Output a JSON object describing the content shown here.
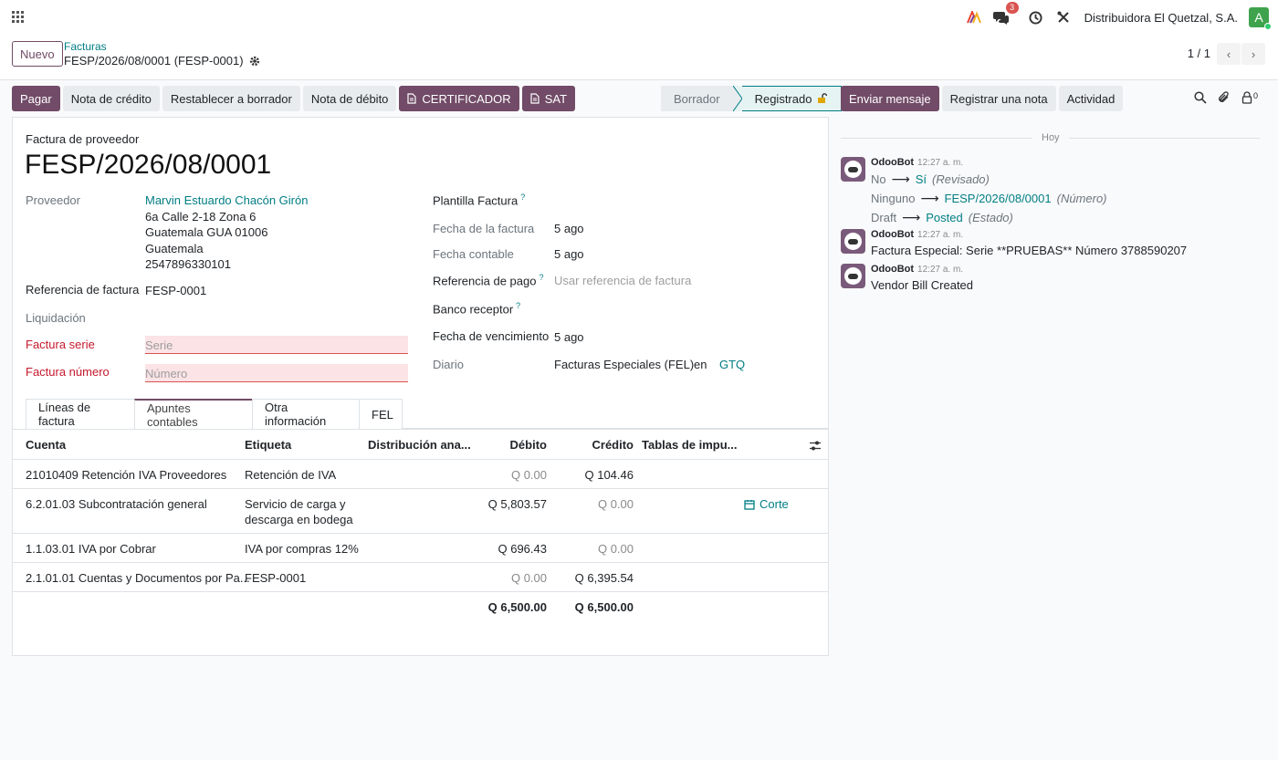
{
  "navbar": {
    "chat_badge": "3",
    "company": "Distribuidora El Quetzal, S.A.",
    "avatar_letter": "A"
  },
  "control_panel": {
    "new_label": "Nuevo",
    "breadcrumb_parent": "Facturas",
    "breadcrumb_current": "FESP/2026/08/0001 (FESP-0001)",
    "pager": "1 / 1"
  },
  "actions": {
    "pay": "Pagar",
    "credit_note": "Nota de crédito",
    "reset_draft": "Restablecer a borrador",
    "debit_note": "Nota de débito",
    "certificador": "CERTIFICADOR",
    "sat": "SAT"
  },
  "status": {
    "stages": [
      "Borrador",
      "Registrado"
    ]
  },
  "chatter_buttons": {
    "send_message": "Enviar mensaje",
    "log_note": "Registrar una nota",
    "activity": "Actividad",
    "followers_count": "0"
  },
  "form": {
    "type_label": "Factura de proveedor",
    "name": "FESP/2026/08/0001",
    "left": {
      "proveedor_label": "Proveedor",
      "proveedor_name": "Marvin Estuardo Chacón Girón",
      "address_lines": [
        "6a Calle 2-18 Zona 6",
        "Guatemala GUA 01006",
        "Guatemala",
        "2547896330101"
      ],
      "ref_label": "Referencia de factura",
      "ref_value": "FESP-0001",
      "liquidacion_label": "Liquidación",
      "serie_label": "Factura serie",
      "serie_placeholder": "Serie",
      "numero_label": "Factura número",
      "numero_placeholder": "Número"
    },
    "right": {
      "plantilla_label": "Plantilla Factura",
      "fecha_factura_label": "Fecha de la factura",
      "fecha_factura_value": "5 ago",
      "fecha_contable_label": "Fecha contable",
      "fecha_contable_value": "5 ago",
      "ref_pago_label": "Referencia de pago",
      "ref_pago_placeholder": "Usar referencia de factura",
      "banco_label": "Banco receptor",
      "vencimiento_label": "Fecha de vencimiento",
      "vencimiento_value": "5 ago",
      "diario_label": "Diario",
      "diario_value": "Facturas Especiales (FEL)",
      "diario_en": "en",
      "diario_currency": "GTQ",
      "help_mark": "?"
    }
  },
  "tabs": [
    "Líneas de factura",
    "Apuntes contables",
    "Otra información",
    "FEL"
  ],
  "table": {
    "headers": [
      "Cuenta",
      "Etiqueta",
      "Distribución ana...",
      "Débito",
      "Crédito",
      "Tablas de impu..."
    ],
    "rows": [
      {
        "cuenta": "21010409 Retención IVA Proveedores",
        "etiqueta": "Retención de IVA",
        "etiqueta2": "",
        "debito": "Q 0.00",
        "credito": "Q 104.46",
        "tag": ""
      },
      {
        "cuenta": "6.2.01.03 Subcontratación general",
        "etiqueta": "Servicio de carga y",
        "etiqueta2": "descarga en bodega",
        "debito": "Q 5,803.57",
        "credito": "Q 0.00",
        "tag": "Corte"
      },
      {
        "cuenta": "1.1.03.01 IVA por Cobrar",
        "etiqueta": "IVA por compras 12%",
        "etiqueta2": "",
        "debito": "Q 696.43",
        "credito": "Q 0.00",
        "tag": ""
      },
      {
        "cuenta": "2.1.01.01 Cuentas y Documentos por Pa...",
        "etiqueta": "FESP-0001",
        "etiqueta2": "",
        "debito": "Q 0.00",
        "credito": "Q 6,395.54",
        "tag": ""
      }
    ],
    "total_debito": "Q 6,500.00",
    "total_credito": "Q 6,500.00"
  },
  "chatter": {
    "day_label": "Hoy",
    "messages": [
      {
        "author": "OdooBot",
        "time": "12:27 a. m.",
        "changes": [
          {
            "old": "No",
            "new": "Sí",
            "field": "(Revisado)"
          },
          {
            "old": "Ninguno",
            "new": "FESP/2026/08/0001",
            "field": "(Número)"
          },
          {
            "old": "Draft",
            "new": "Posted",
            "field": "(Estado)"
          }
        ]
      },
      {
        "author": "OdooBot",
        "time": "12:27 a. m.",
        "body": "Factura Especial: Serie **PRUEBAS** Número 3788590207"
      },
      {
        "author": "OdooBot",
        "time": "12:27 a. m.",
        "body": "Vendor Bill Created"
      }
    ]
  },
  "colors": {
    "brand": "#714b67",
    "link": "#017e84",
    "required": "#c5192d"
  }
}
